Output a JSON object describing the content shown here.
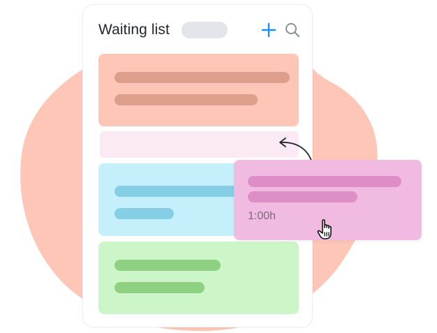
{
  "panel": {
    "title": "Waiting list",
    "add_icon": "plus-icon",
    "search_icon": "search-icon"
  },
  "drag_card": {
    "duration": "1:00h"
  },
  "colors": {
    "blob": "#fec6b7",
    "accent": "#1c8ef0",
    "card_salmon": "#fec6b7",
    "card_blue": "#c5f0fb",
    "card_green": "#cdf6c8",
    "card_pink": "#f1bbe1",
    "drop_slot": "#fbe9f3"
  },
  "icons": {
    "cursor": "hand-pointer-icon",
    "arrow": "curved-arrow-icon"
  }
}
